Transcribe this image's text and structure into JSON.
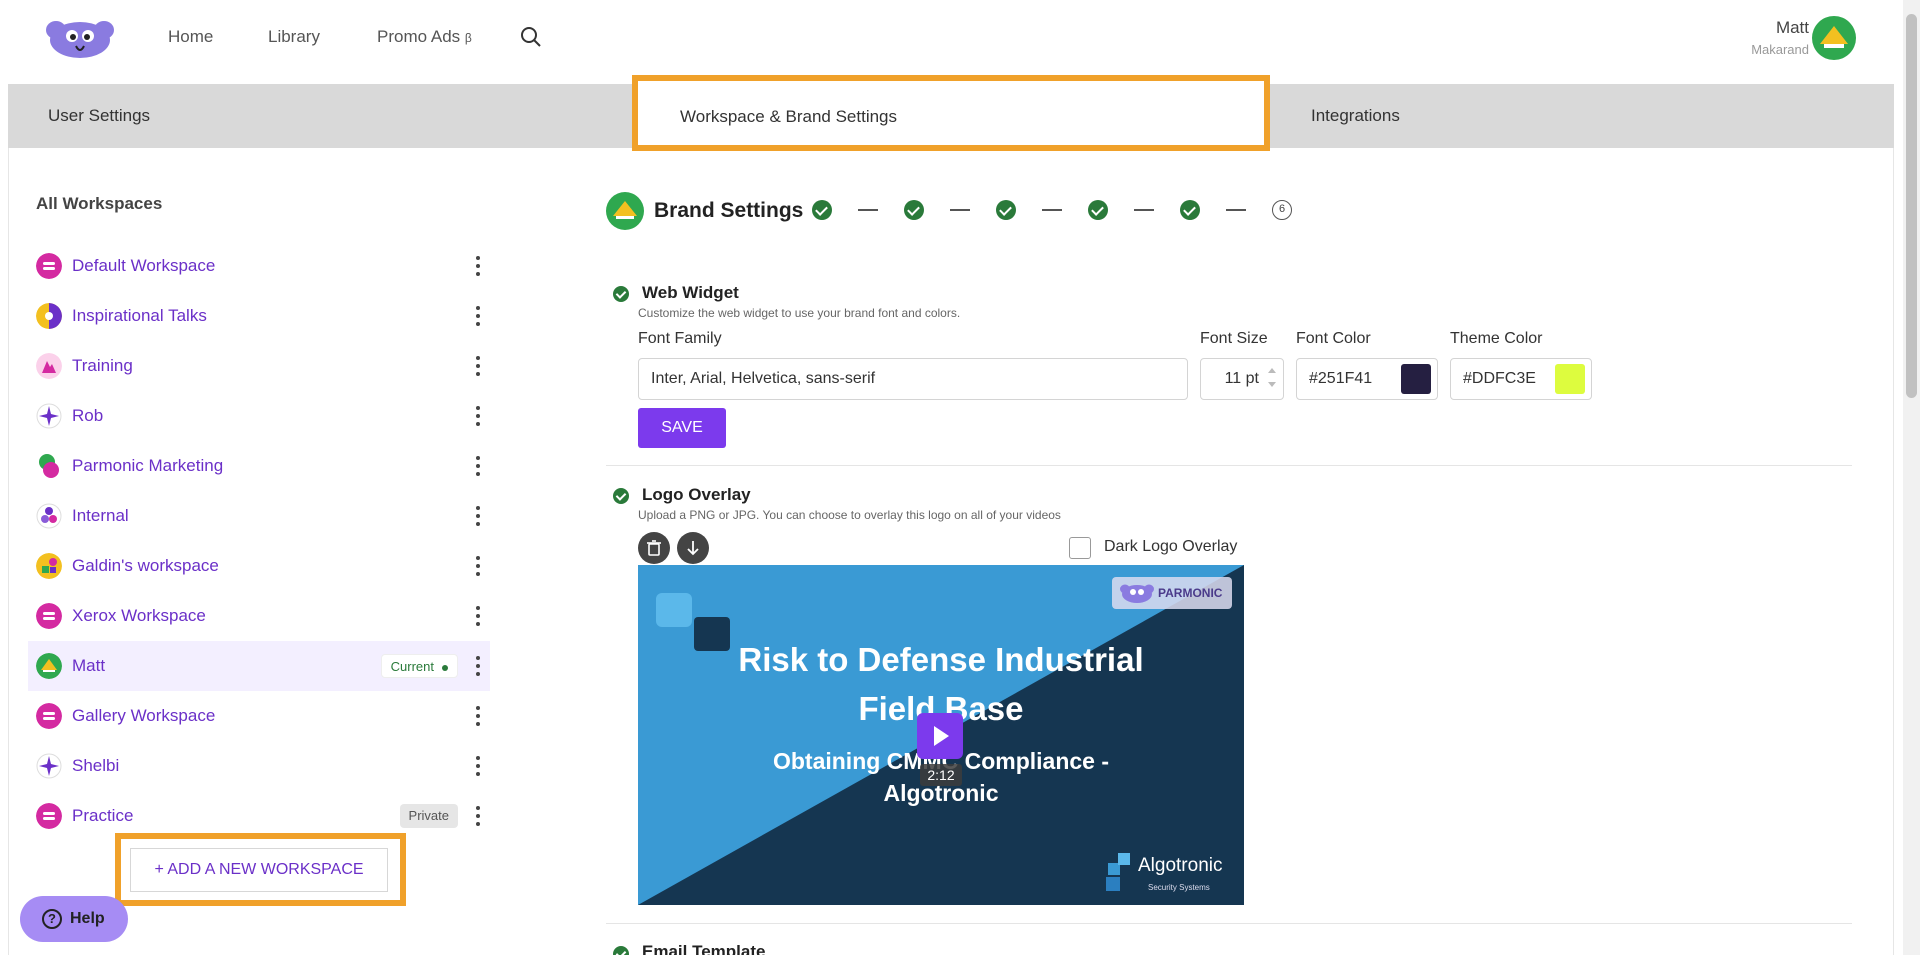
{
  "nav": {
    "home": "Home",
    "library": "Library",
    "promo": "Promo Ads",
    "promo_beta": "β"
  },
  "user": {
    "name": "Matt",
    "subtitle": "Makarand"
  },
  "tabs": {
    "user_settings": "User Settings",
    "workspace_brand": "Workspace & Brand Settings",
    "integrations": "Integrations"
  },
  "workspaces": {
    "heading": "All Workspaces",
    "items": [
      {
        "label": "Default Workspace",
        "icon": "workspace-avatar-magenta"
      },
      {
        "label": "Inspirational Talks",
        "icon": "workspace-avatar-purple-yellow"
      },
      {
        "label": "Training",
        "icon": "workspace-avatar-pink-mountain"
      },
      {
        "label": "Rob",
        "icon": "workspace-avatar-purple-star"
      },
      {
        "label": "Parmonic Marketing",
        "icon": "workspace-avatar-green-magenta"
      },
      {
        "label": "Internal",
        "icon": "workspace-avatar-purple-dots"
      },
      {
        "label": "Galdin's workspace",
        "icon": "workspace-avatar-yellow-shapes"
      },
      {
        "label": "Xerox Workspace",
        "icon": "workspace-avatar-magenta"
      },
      {
        "label": "Matt",
        "icon": "workspace-avatar-green-arrow",
        "badge": "Current"
      },
      {
        "label": "Gallery Workspace",
        "icon": "workspace-avatar-magenta"
      },
      {
        "label": "Shelbi",
        "icon": "workspace-avatar-purple-star"
      },
      {
        "label": "Practice",
        "icon": "workspace-avatar-magenta",
        "badge": "Private"
      }
    ],
    "add_button": "+ ADD A NEW WORKSPACE"
  },
  "help": "Help",
  "brand": {
    "title": "Brand Settings",
    "last_step": "6"
  },
  "web_widget": {
    "title": "Web Widget",
    "description": "Customize the web widget to use your brand font and colors.",
    "font_family_label": "Font Family",
    "font_family_value": "Inter, Arial, Helvetica, sans-serif",
    "font_size_label": "Font Size",
    "font_size_value": "11 pt",
    "font_color_label": "Font Color",
    "font_color_value": "#251F41",
    "theme_color_label": "Theme Color",
    "theme_color_value": "#DDFC3E",
    "save": "SAVE"
  },
  "logo_overlay": {
    "title": "Logo Overlay",
    "description": "Upload a PNG or JPG. You can choose to overlay this logo on all of your videos",
    "dark_overlay_label": "Dark Logo Overlay",
    "dark_overlay_checked": false
  },
  "video": {
    "title_line1": "Risk to Defense Industrial",
    "title_line2": "Field Base",
    "subtitle_line1": "Obtaining CMMC Compliance -",
    "subtitle_line2": "Algotronic",
    "duration": "2:12",
    "badge_text": "PARMONIC",
    "brand_name": "Algotronic",
    "brand_sub": "Security Systems"
  },
  "email_template": {
    "title": "Email Template"
  },
  "colors": {
    "accent": "#7c3aed",
    "link": "#6b30c8",
    "highlight": "#f0a12a",
    "success": "#2a7a3a",
    "font_color_swatch": "#251F41",
    "theme_color_swatch": "#DDFC3E"
  }
}
